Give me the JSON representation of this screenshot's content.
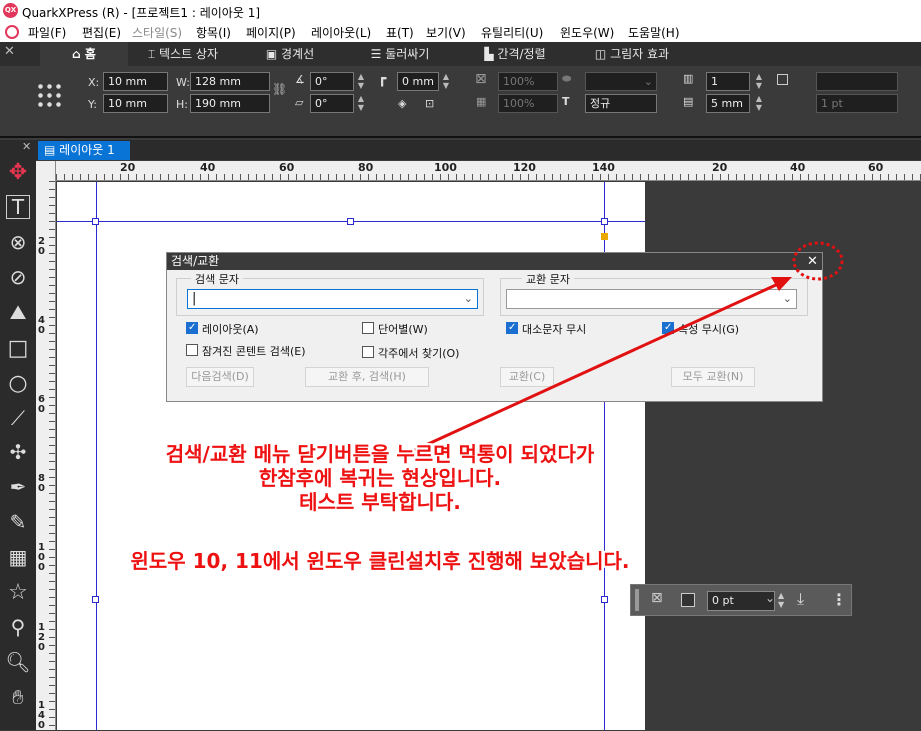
{
  "window": {
    "title": "QuarkXPress (R) - [프로젝트1 : 레이아웃 1]"
  },
  "menu": [
    "파일(F)",
    "편집(E)",
    "스타일(S)",
    "항목(I)",
    "페이지(P)",
    "레이아웃(L)",
    "표(T)",
    "보기(V)",
    "유틸리티(U)",
    "윈도우(W)",
    "도움말(H)"
  ],
  "tabs": [
    "홈",
    "텍스트 상자",
    "경계선",
    "둘러싸기",
    "간격/정렬",
    "그림자 효과"
  ],
  "measure": {
    "x_label": "X:",
    "x_value": "10 mm",
    "y_label": "Y:",
    "y_value": "10 mm",
    "w_label": "W:",
    "w_value": "128 mm",
    "h_label": "H:",
    "h_value": "190 mm",
    "angle_value": "0°",
    "skew_value": "0°",
    "corner_value": "0 mm",
    "opacity1": "100%",
    "opacity2": "100%",
    "style_value": "정규",
    "columns_value": "1",
    "gutter_value": "5 mm",
    "stroke_value": "1 pt"
  },
  "document": {
    "tab_label": "레이아웃 1"
  },
  "ruler": {
    "h_ticks": [
      "20",
      "40",
      "60",
      "80",
      "100",
      "120",
      "140",
      "20",
      "40",
      "60"
    ],
    "v_ticks": [
      "20",
      "40",
      "60",
      "80",
      "100",
      "120",
      "140"
    ]
  },
  "dialog": {
    "title": "검색/교환",
    "find_label": "검색 문자",
    "find_value": "",
    "replace_label": "교환 문자",
    "replace_value": "",
    "options": [
      {
        "label": "레이아웃(A)",
        "checked": true
      },
      {
        "label": "단어별(W)",
        "checked": false
      },
      {
        "label": "대소문자 무시",
        "checked": true
      },
      {
        "label": "속성 무시(G)",
        "checked": true
      },
      {
        "label": "잠겨진 콘텐트 검색(E)",
        "checked": false
      },
      {
        "label": "각주에서 찾기(O)",
        "checked": false
      }
    ],
    "buttons": [
      "다음검색(D)",
      "교환 후, 검색(H)",
      "교환(C)",
      "모두 교환(N)"
    ]
  },
  "annotation": {
    "line1": "검색/교환  메뉴 닫기버튼을 누르면 먹통이 되었다가",
    "line2": "한참후에 복귀는 현상입니다.",
    "line3": "테스트 부탁합니다.",
    "line4": "윈도우 10, 11에서 윈도우 클린설치후 진행해 보았습니다.",
    "color": "#e11111"
  },
  "floating_toolbar": {
    "stroke_value": "0 pt"
  },
  "colors": {
    "accent": "#0a74d6",
    "annotation": "#e11111"
  }
}
